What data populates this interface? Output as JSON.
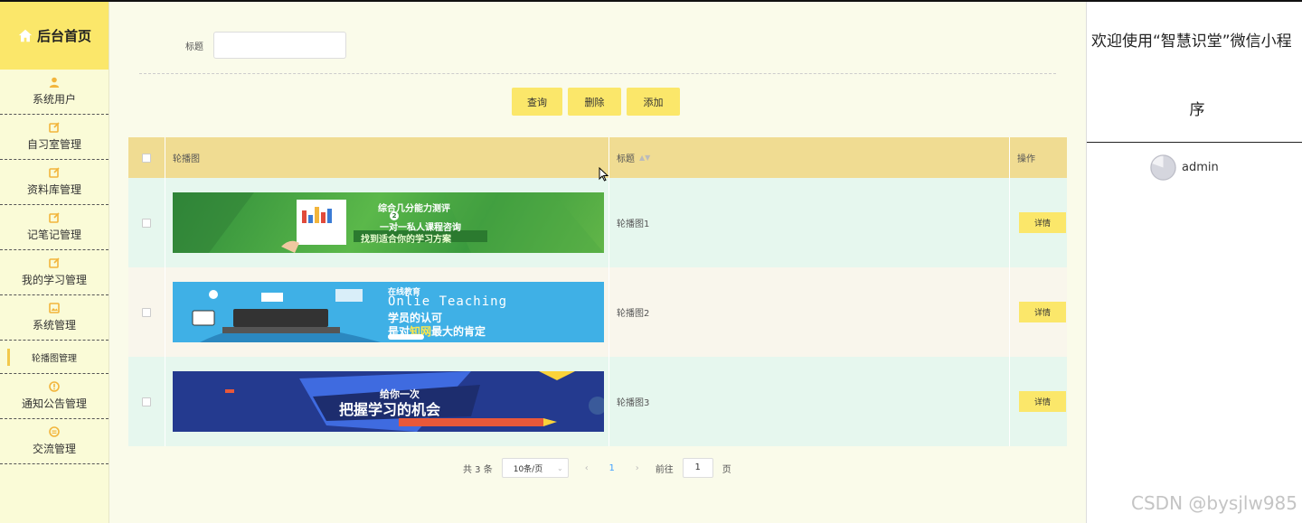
{
  "sidebar": {
    "brand": "后台首页",
    "items": [
      {
        "label": "系统用户",
        "icon": "user-icon"
      },
      {
        "label": "自习室管理",
        "icon": "edit-icon"
      },
      {
        "label": "资料库管理",
        "icon": "edit-icon"
      },
      {
        "label": "记笔记管理",
        "icon": "edit-icon"
      },
      {
        "label": "我的学习管理",
        "icon": "edit-icon"
      },
      {
        "label": "系统管理",
        "icon": "picture-icon"
      },
      {
        "label": "轮播图管理",
        "icon": "none",
        "active": true
      },
      {
        "label": "通知公告管理",
        "icon": "info-icon"
      },
      {
        "label": "交流管理",
        "icon": "chat-icon"
      }
    ]
  },
  "search": {
    "label": "标题",
    "value": "",
    "placeholder": ""
  },
  "toolbar": {
    "query_label": "查询",
    "delete_label": "删除",
    "add_label": "添加"
  },
  "table": {
    "columns": [
      "轮播图",
      "标题",
      "操作"
    ],
    "rows": [
      {
        "title": "轮播图1",
        "action": "详情",
        "banner_text": [
          "综合几分能力测评",
          "2",
          "一对一私人课程咨询",
          "找到适合你的学习方案"
        ]
      },
      {
        "title": "轮播图2",
        "action": "详情",
        "banner_text": [
          "在线教育",
          "Onlie Teaching",
          "学员的认可",
          "是对",
          "知网",
          "最大的肯定"
        ]
      },
      {
        "title": "轮播图3",
        "action": "详情",
        "banner_text": [
          "给你一次",
          "把握学习的机会"
        ]
      }
    ]
  },
  "pagination": {
    "total": "共 3 条",
    "page_size": "10条/页",
    "current": "1",
    "goto_prefix": "前往",
    "goto_value": "1",
    "goto_suffix": "页"
  },
  "right_panel": {
    "welcome_line1": "欢迎使用“智慧识堂”微信小程",
    "welcome_line2": "序",
    "username": "admin"
  },
  "watermark": "CSDN @bysjlw985",
  "colors": {
    "accent": "#fbe76a",
    "header": "#f0dc92",
    "background": "#fafbea",
    "link": "#409eff"
  }
}
